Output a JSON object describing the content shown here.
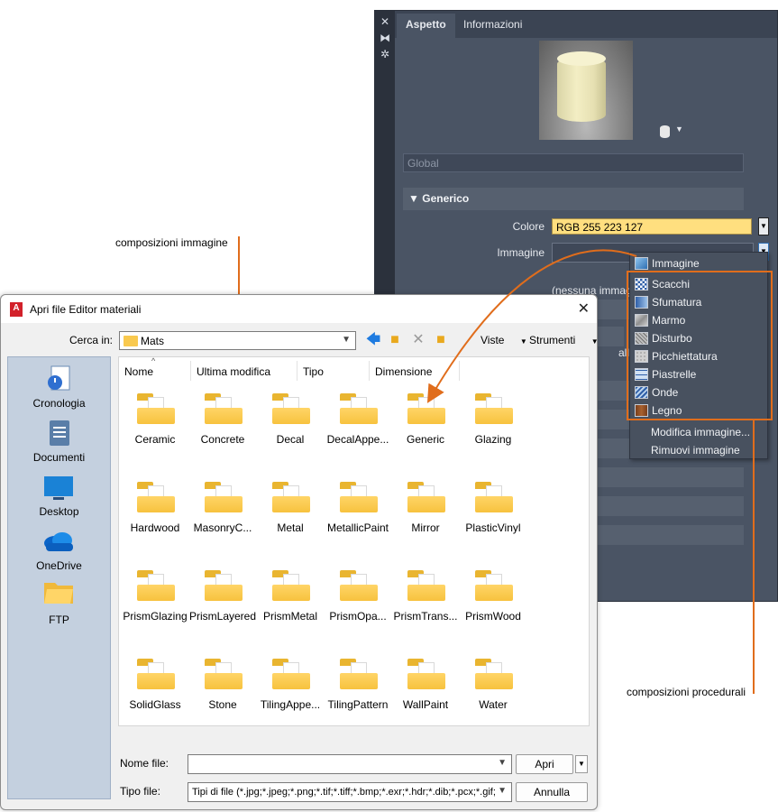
{
  "palette": {
    "tabs": [
      "Aspetto",
      "Informazioni"
    ],
    "strip_icons": [
      "close-icon",
      "autohide-icon",
      "settings-icon"
    ],
    "global_placeholder": "Global",
    "section_title": "Generico",
    "color_label": "Colore",
    "color_value": "RGB 255 223 127",
    "color_swatch": "#ffdf7f",
    "image_label": "Immagine",
    "none_image_text": "(nessuna immag",
    "metallic_text": "allico"
  },
  "image_menu": {
    "items": [
      {
        "label": "Immagine",
        "icon": "image-icon"
      },
      {
        "label": "Scacchi",
        "icon": "checker-icon"
      },
      {
        "label": "Sfumatura",
        "icon": "gradient-icon"
      },
      {
        "label": "Marmo",
        "icon": "marble-icon"
      },
      {
        "label": "Disturbo",
        "icon": "noise-icon"
      },
      {
        "label": "Picchiettatura",
        "icon": "speckle-icon"
      },
      {
        "label": "Piastrelle",
        "icon": "tiles-icon"
      },
      {
        "label": "Onde",
        "icon": "waves-icon"
      },
      {
        "label": "Legno",
        "icon": "wood-icon"
      },
      {
        "label": "Modifica immagine...",
        "icon": ""
      },
      {
        "label": "Rimuovi immagine",
        "icon": ""
      }
    ]
  },
  "callouts": {
    "image_compositions": "composizioni immagine",
    "procedural_compositions": "composizioni procedurali",
    "accent": "#e06d1c"
  },
  "dialog": {
    "app_icon": "A",
    "title": "Apri file Editor materiali",
    "look_in_label": "Cerca in:",
    "look_in_value": "Mats",
    "views_label": "Viste",
    "tools_label": "Strumenti",
    "places": [
      {
        "label": "Cronologia",
        "icon": "history-icon"
      },
      {
        "label": "Documenti",
        "icon": "documents-icon"
      },
      {
        "label": "Desktop",
        "icon": "desktop-icon"
      },
      {
        "label": "OneDrive",
        "icon": "onedrive-icon"
      },
      {
        "label": "FTP",
        "icon": "ftp-icon"
      }
    ],
    "columns": [
      "Nome",
      "Ultima modifica",
      "Tipo",
      "Dimensione"
    ],
    "folders": [
      "Ceramic",
      "Concrete",
      "Decal",
      "DecalAppe...",
      "Generic",
      "Glazing",
      "Hardwood",
      "MasonryC...",
      "Metal",
      "MetallicPaint",
      "Mirror",
      "PlasticVinyl",
      "PrismGlazing",
      "PrismLayered",
      "PrismMetal",
      "PrismOpa...",
      "PrismTrans...",
      "PrismWood",
      "SolidGlass",
      "Stone",
      "TilingAppe...",
      "TilingPattern",
      "WallPaint",
      "Water"
    ],
    "file_name_label": "Nome file:",
    "file_name_value": "",
    "file_type_label": "Tipo file:",
    "file_type_value": "Tipi di file  (*.jpg;*.jpeg;*.png;*.tif;*.tiff;*.bmp;*.exr;*.hdr;*.dib;*.pcx;*.gif;*.t",
    "open_button": "Apri",
    "cancel_button": "Annulla"
  }
}
